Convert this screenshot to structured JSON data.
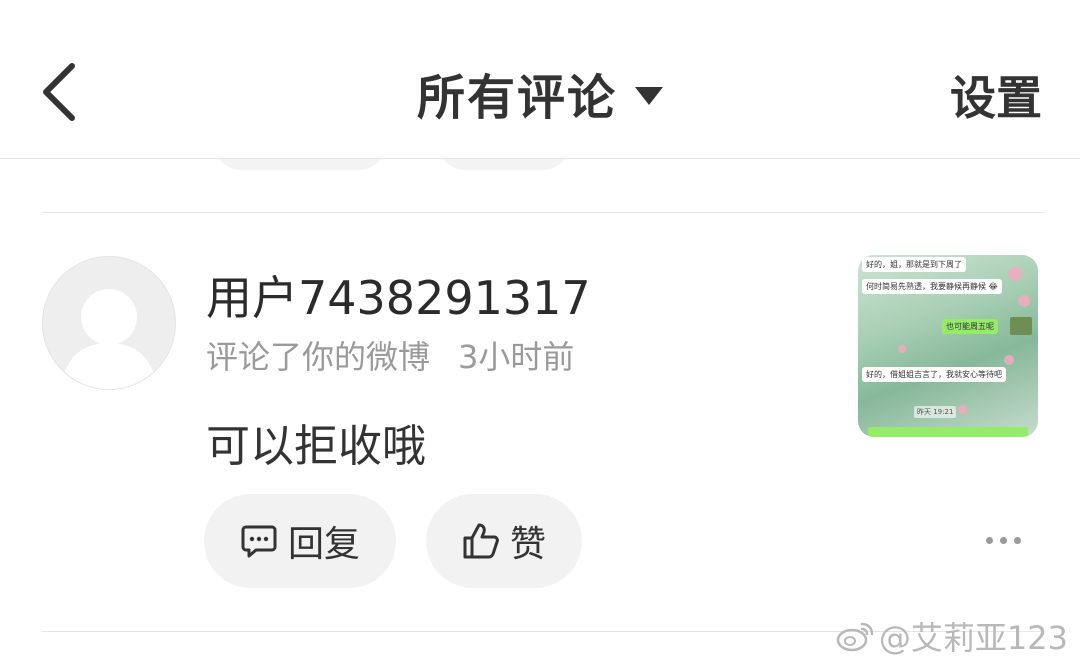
{
  "header": {
    "title": "所有评论",
    "settings_label": "设置"
  },
  "comment": {
    "username": "用户7438291317",
    "action": "评论了你的微博",
    "time": "3小时前",
    "content": "可以拒收哦",
    "reply_label": "回复",
    "like_label": "赞",
    "thumbnail": {
      "messages": [
        {
          "text": "好的，姐，那就是到下周了",
          "side": "left"
        },
        {
          "text": "何时简易先熟透，我要静候再静候 😂",
          "side": "left"
        },
        {
          "text": "也可能周五呢",
          "side": "right"
        },
        {
          "text": "好的，借姐姐吉言了，我就安心等待吧",
          "side": "left"
        },
        {
          "text": "昨天 19:21",
          "side": "center"
        }
      ]
    }
  },
  "watermark": "@艾莉亚123",
  "colors": {
    "background": "#ffffff",
    "pill": "#f2f2f2",
    "meta_text": "#9a9a9a",
    "divider": "#e6e6e6"
  }
}
